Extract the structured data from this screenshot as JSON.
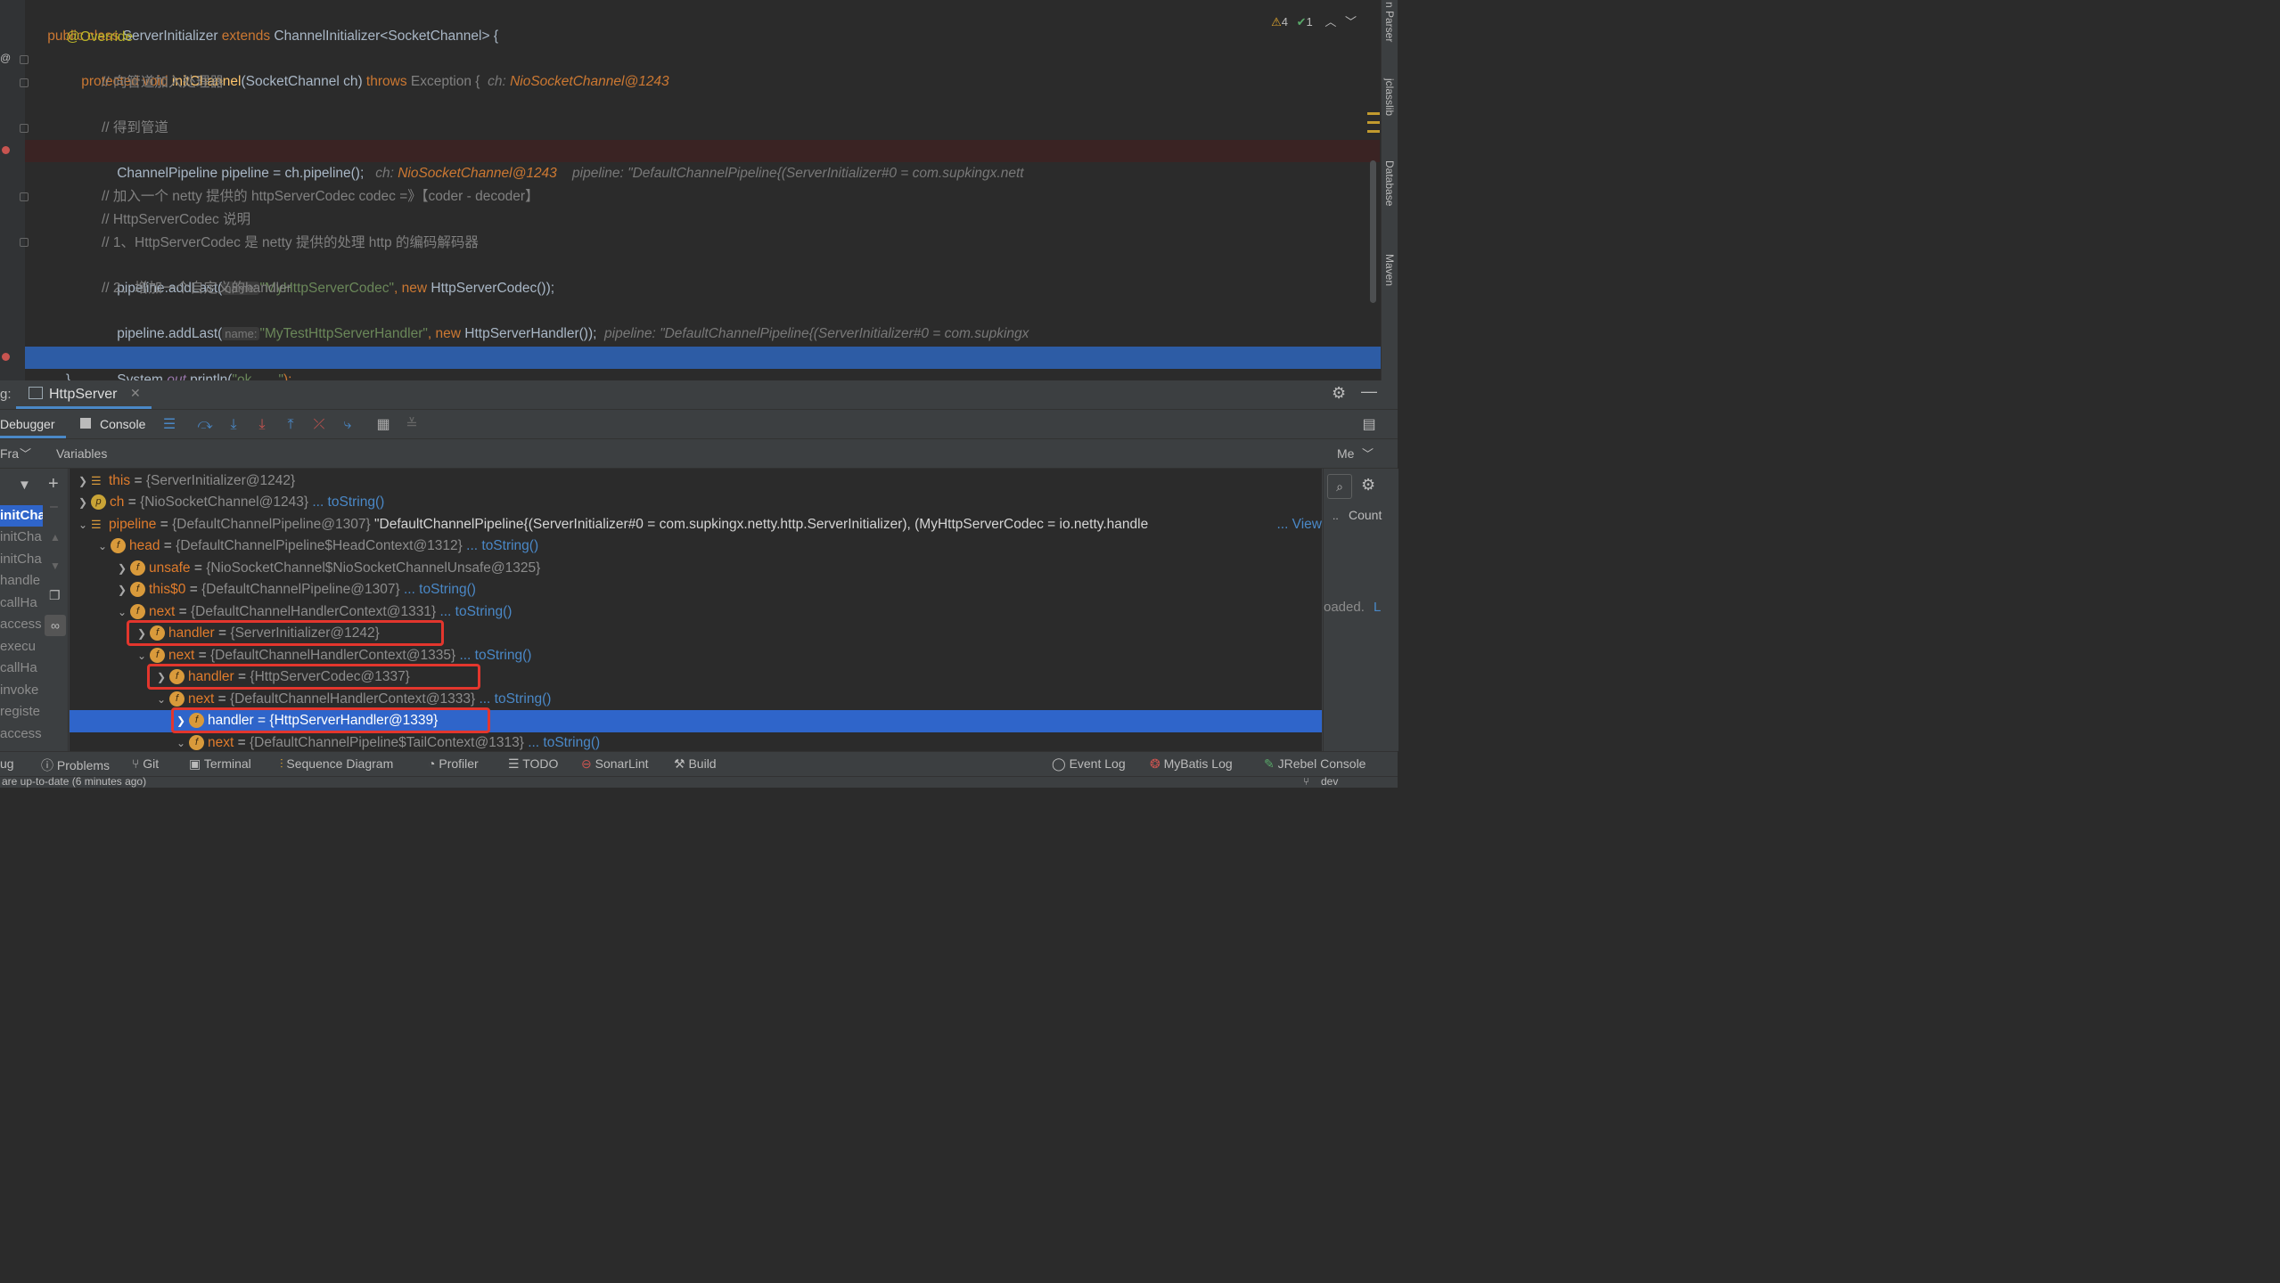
{
  "editor": {
    "lines": {
      "l1_kw1": "public class",
      "l1_cls": "ServerInitializer",
      "l1_kw2": "extends",
      "l1_rest": "ChannelInitializer<SocketChannel> {",
      "l2": "@Override",
      "l3_kw": "protected void",
      "l3_fn": "initChannel",
      "l3_args": "(SocketChannel ch)",
      "l3_throws": "throws",
      "l3_exc": "Exception {",
      "l3_inl": "ch:",
      "l3_inlv": "NioSocketChannel@1243",
      "l4": "// 向管道加入处理器",
      "l6": "// 得到管道",
      "l7_code": "ChannelPipeline pipeline = ch.pipeline();",
      "l7_inl1": "ch:",
      "l7_inlv1": "NioSocketChannel@1243",
      "l7_inl2": "pipeline: \"DefaultChannelPipeline{(ServerInitializer#0 = com.supkingx.nett",
      "l9": "// 加入一个 netty 提供的 httpServerCodec codec =》【coder - decoder】",
      "l10": "// HttpServerCodec 说明",
      "l11": "// 1、HttpServerCodec 是 netty 提供的处理 http 的编码解码器",
      "l12_a": "pipeline.addLast(",
      "l12_hint": "name:",
      "l12_str": "\"MyHttpServerCodec\"",
      "l12_b": ",",
      "l12_new": "new",
      "l12_c": "HttpServerCodec());",
      "l13": "// 2、增加一个自定义的handler",
      "l14_a": "pipeline.addLast(",
      "l14_hint": "name:",
      "l14_str": "\"MyTestHttpServerHandler\"",
      "l14_b": ",",
      "l14_new": "new",
      "l14_c": "HttpServerHandler());",
      "l14_inl": "pipeline: \"DefaultChannelPipeline{(ServerInitializer#0 = com.supkingx",
      "l16_a": "System.",
      "l16_out": "out",
      "l16_b": ".println(",
      "l16_str": "\"ok.......\"",
      "l16_c": ");",
      "l17": "}"
    },
    "warnings": "4",
    "checks": "1"
  },
  "right_strip": [
    "n Parser",
    "jclasslib",
    "Database",
    "Maven"
  ],
  "debug": {
    "title_prefix": "g:",
    "run_tab": "HttpServer",
    "tabs": {
      "debugger": "Debugger",
      "console": "Console"
    },
    "frames_label": "Fra",
    "variables_label": "Variables",
    "memory_label": "Me",
    "count_label": "Count",
    "loaded_text": "oaded.",
    "loaded_link": "L",
    "frames": [
      "initCha",
      "initCha",
      "initCha",
      "handle",
      "callHa",
      "access",
      "execu",
      "callHa",
      "invoke",
      "registe",
      "access"
    ]
  },
  "variables": [
    {
      "name": "this",
      "eq": "=",
      "val": "{ServerInitializer@1242}",
      "link": "",
      "extra": ""
    },
    {
      "name": "ch",
      "eq": "=",
      "val": "{NioSocketChannel@1243}",
      "link": "... toString()",
      "extra": ""
    },
    {
      "name": "pipeline",
      "eq": "=",
      "val": "{DefaultChannelPipeline@1307}",
      "link": "",
      "extra": "\"DefaultChannelPipeline{(ServerInitializer#0 = com.supkingx.netty.http.ServerInitializer), (MyHttpServerCodec = io.netty.handle",
      "view": "... View"
    },
    {
      "name": "head",
      "eq": "=",
      "val": "{DefaultChannelPipeline$HeadContext@1312}",
      "link": "... toString()",
      "extra": ""
    },
    {
      "name": "unsafe",
      "eq": "=",
      "val": "{NioSocketChannel$NioSocketChannelUnsafe@1325}",
      "link": "",
      "extra": ""
    },
    {
      "name": "this$0",
      "eq": "=",
      "val": "{DefaultChannelPipeline@1307}",
      "link": "... toString()",
      "extra": ""
    },
    {
      "name": "next",
      "eq": "=",
      "val": "{DefaultChannelHandlerContext@1331}",
      "link": "... toString()",
      "extra": ""
    },
    {
      "name": "handler",
      "eq": "=",
      "val": "{ServerInitializer@1242}",
      "link": "",
      "extra": ""
    },
    {
      "name": "next",
      "eq": "=",
      "val": "{DefaultChannelHandlerContext@1335}",
      "link": "... toString()",
      "extra": ""
    },
    {
      "name": "handler",
      "eq": "=",
      "val": "{HttpServerCodec@1337}",
      "link": "",
      "extra": ""
    },
    {
      "name": "next",
      "eq": "=",
      "val": "{DefaultChannelHandlerContext@1333}",
      "link": "... toString()",
      "extra": ""
    },
    {
      "name": "handler",
      "eq": "=",
      "val": "{HttpServerHandler@1339}",
      "link": "",
      "extra": ""
    },
    {
      "name": "next",
      "eq": "=",
      "val": "{DefaultChannelPipeline$TailContext@1313}",
      "link": "... toString()",
      "extra": ""
    }
  ],
  "bottom": {
    "debug": "ug",
    "problems": "Problems",
    "git": "Git",
    "terminal": "Terminal",
    "sequence": "Sequence Diagram",
    "profiler": "Profiler",
    "todo": "TODO",
    "sonarlint": "SonarLint",
    "build": "Build",
    "eventlog": "Event Log",
    "mybatis": "MyBatis Log",
    "jrebel": "JRebel Console"
  },
  "status": {
    "text": "are up-to-date (6 minutes ago)",
    "branch": "dev"
  }
}
